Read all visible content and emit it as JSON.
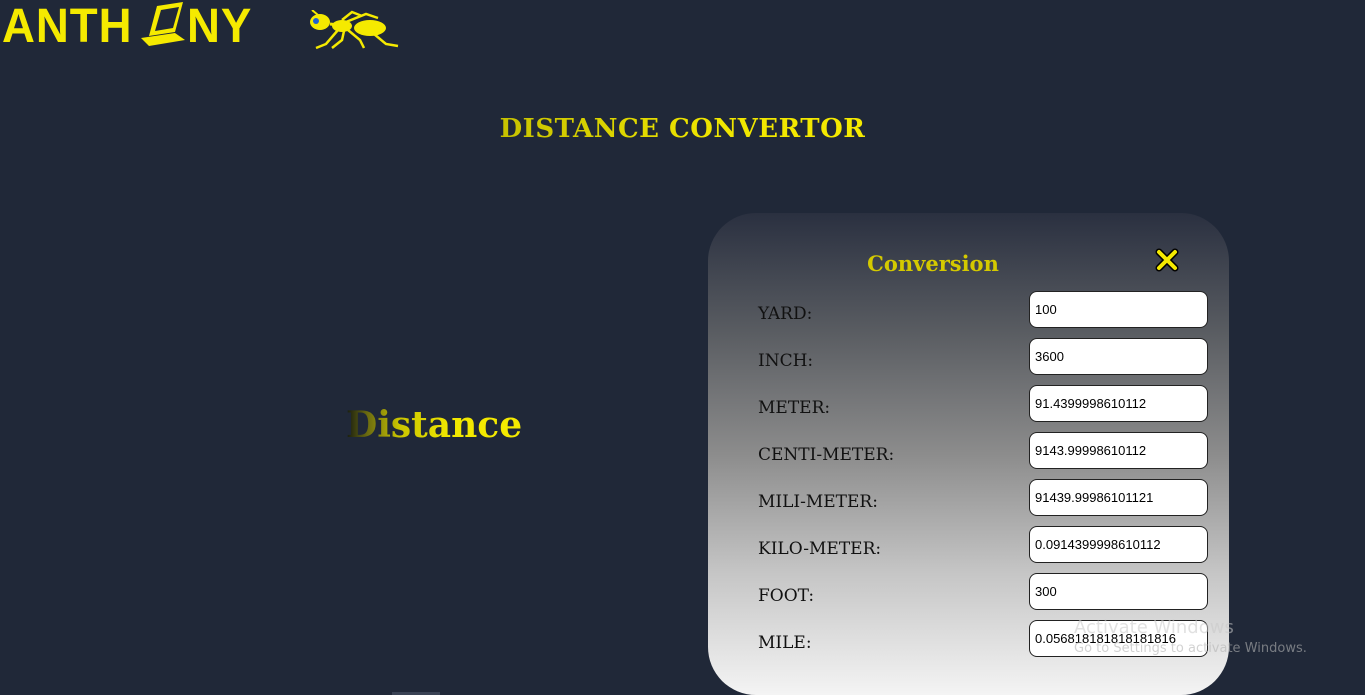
{
  "logo": {
    "text_before": "ANTH",
    "text_after": "NY",
    "colors": {
      "brand": "#f5ea00"
    }
  },
  "page": {
    "title": "DISTANCE CONVERTOR",
    "side_word": "Distance"
  },
  "panel": {
    "title": "Conversion",
    "close_icon": "close-x-icon",
    "rows": [
      {
        "label": "YARD:",
        "value": "100"
      },
      {
        "label": "INCH:",
        "value": "3600"
      },
      {
        "label": "METER:",
        "value": "91.4399998610112"
      },
      {
        "label": "CENTI-METER:",
        "value": "9143.99998610112"
      },
      {
        "label": "MILI-METER:",
        "value": "91439.99986101121"
      },
      {
        "label": "KILO-METER:",
        "value": "0.0914399998610112"
      },
      {
        "label": "FOOT:",
        "value": "300"
      },
      {
        "label": "MILE:",
        "value": "0.056818181818181816"
      }
    ]
  },
  "watermark": {
    "line1": "Activate Windows",
    "line2": "Go to Settings to activate Windows."
  },
  "colors": {
    "background": "#202838",
    "accent": "#f5ea00"
  }
}
